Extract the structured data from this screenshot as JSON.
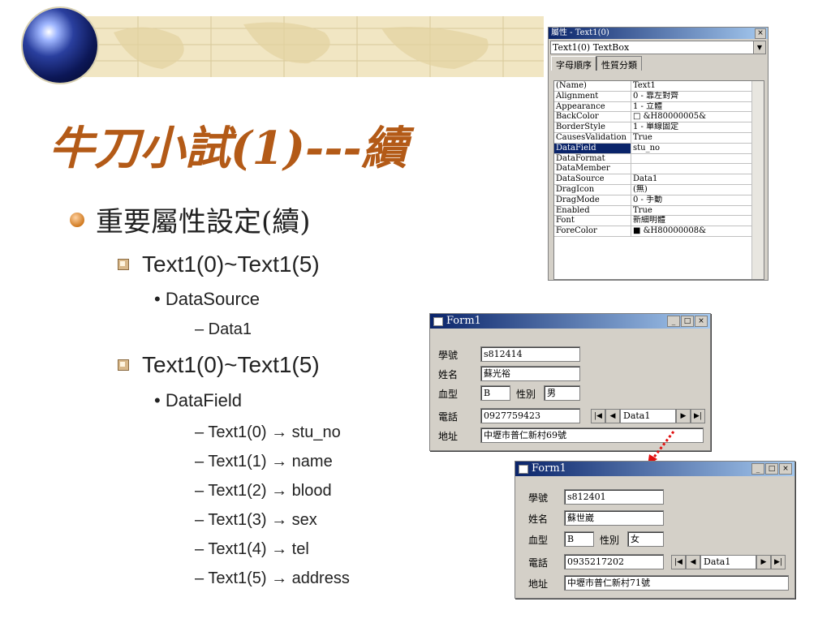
{
  "slide": {
    "title": "牛刀小試(1)---續",
    "bullets": {
      "level1": "重要屬性設定(續)",
      "group1_header": "Text1(0)~Text1(5)",
      "group1_property": "DataSource",
      "group1_value": "– Data1",
      "group2_header": "Text1(0)~Text1(5)",
      "group2_property": "DataField",
      "mappings": [
        "– Text1(0) → stu_no",
        "– Text1(1) → name",
        "– Text1(2) → blood",
        "– Text1(3) → sex",
        "– Text1(4) → tel",
        "– Text1(5) → address"
      ]
    }
  },
  "properties_window": {
    "title": "屬性 - Text1(0)",
    "close": "×",
    "object_selector": "Text1(0) TextBox",
    "tabs": [
      "字母順序",
      "性質分類"
    ],
    "rows": [
      {
        "k": "(Name)",
        "v": "Text1"
      },
      {
        "k": "Alignment",
        "v": "0 - 靠左對齊"
      },
      {
        "k": "Appearance",
        "v": "1 - 立體"
      },
      {
        "k": "BackColor",
        "v": "□ &H80000005&"
      },
      {
        "k": "BorderStyle",
        "v": "1 - 單線固定"
      },
      {
        "k": "CausesValidation",
        "v": "True"
      },
      {
        "k": "DataField",
        "v": "stu_no"
      },
      {
        "k": "DataFormat",
        "v": ""
      },
      {
        "k": "DataMember",
        "v": ""
      },
      {
        "k": "DataSource",
        "v": "Data1"
      },
      {
        "k": "DragIcon",
        "v": "(無)"
      },
      {
        "k": "DragMode",
        "v": "0 - 手動"
      },
      {
        "k": "Enabled",
        "v": "True"
      },
      {
        "k": "Font",
        "v": "新細明體"
      },
      {
        "k": "ForeColor",
        "v": "■ &H80000008&"
      }
    ],
    "selected_row": "DataField"
  },
  "form1_top": {
    "title": "Form1",
    "labels": {
      "id": "學號",
      "name": "姓名",
      "blood": "血型",
      "sex": "性別",
      "tel": "電話",
      "address": "地址"
    },
    "values": {
      "id": "s812414",
      "name": "蘇光裕",
      "blood": "B",
      "sex": "男",
      "tel": "0927759423",
      "address": "中壢市普仁新村69號"
    },
    "data_control": "Data1"
  },
  "form1_bottom": {
    "title": "Form1",
    "labels": {
      "id": "學號",
      "name": "姓名",
      "blood": "血型",
      "sex": "性別",
      "tel": "電話",
      "address": "地址"
    },
    "values": {
      "id": "s812401",
      "name": "蘇世崴",
      "blood": "B",
      "sex": "女",
      "tel": "0935217202",
      "address": "中壢市普仁新村71號"
    },
    "data_control": "Data1"
  },
  "window_buttons": {
    "minimize": "_",
    "maximize": "□",
    "close": "×"
  },
  "nav_glyphs": {
    "first": "|◀",
    "prev": "◀",
    "next": "▶",
    "last": "▶|"
  },
  "colors": {
    "title": "#b35a17",
    "banner": "#efe3bf",
    "titlebar": "#0a246a",
    "arrow": "#e01010"
  }
}
